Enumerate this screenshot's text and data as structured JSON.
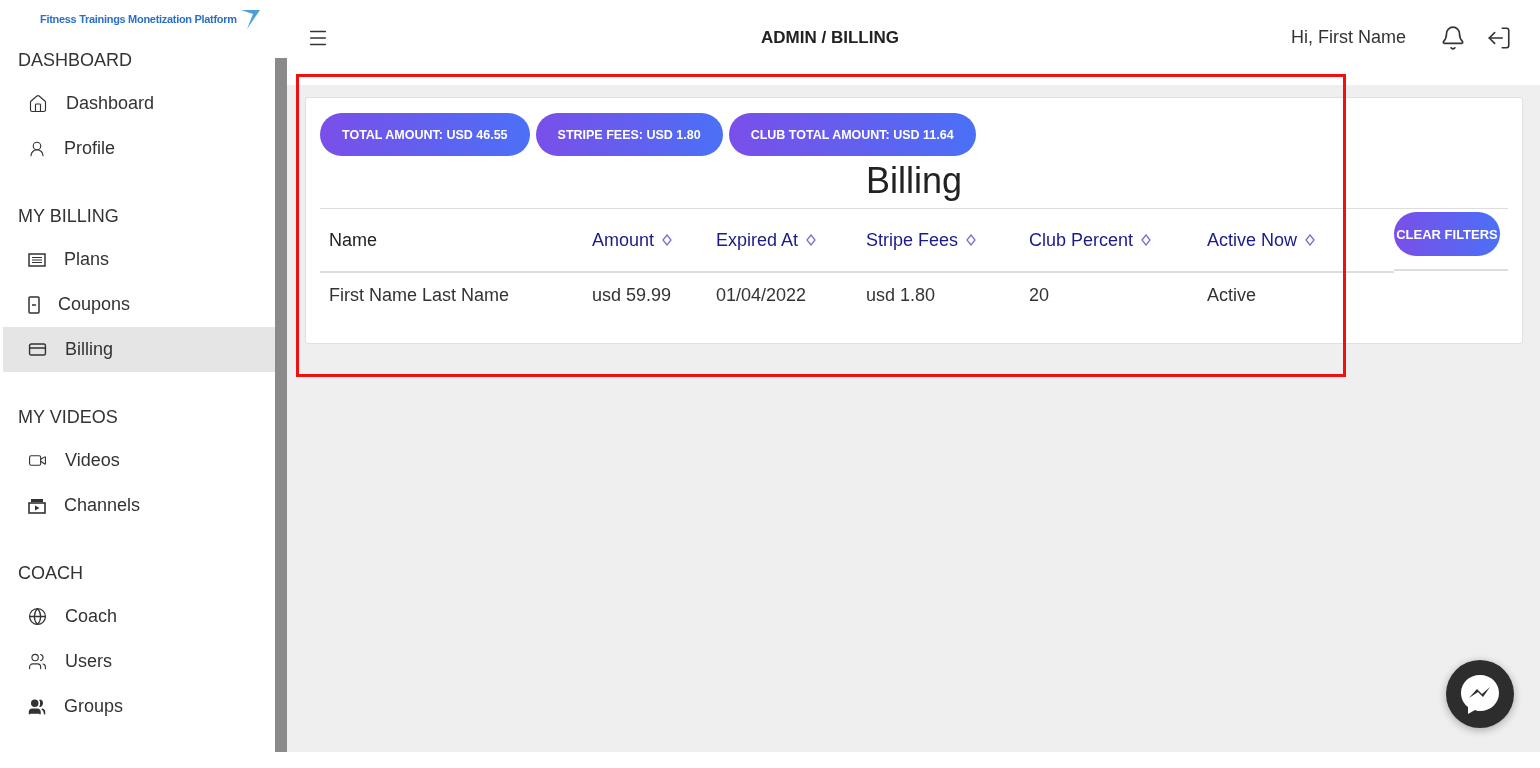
{
  "logo": {
    "text": "Fitness Trainings Monetization Platform"
  },
  "sidebar": {
    "sections": [
      {
        "title": "DASHBOARD",
        "items": [
          {
            "label": "Dashboard",
            "selected": false
          },
          {
            "label": "Profile",
            "selected": false
          }
        ]
      },
      {
        "title": "MY BILLING",
        "items": [
          {
            "label": "Plans",
            "selected": false
          },
          {
            "label": "Coupons",
            "selected": false
          },
          {
            "label": "Billing",
            "selected": true
          }
        ]
      },
      {
        "title": "MY VIDEOS",
        "items": [
          {
            "label": "Videos",
            "selected": false
          },
          {
            "label": "Channels",
            "selected": false
          }
        ]
      },
      {
        "title": "COACH",
        "items": [
          {
            "label": "Coach",
            "selected": false
          },
          {
            "label": "Users",
            "selected": false
          },
          {
            "label": "Groups",
            "selected": false
          }
        ]
      }
    ]
  },
  "header": {
    "breadcrumb": "ADMIN / BILLING",
    "greeting": "Hi, First Name"
  },
  "summary_chips": [
    "TOTAL AMOUNT: USD 46.55",
    "STRIPE FEES: USD 1.80",
    "CLUB TOTAL AMOUNT: USD 11.64"
  ],
  "title": "Billing",
  "table": {
    "columns": [
      {
        "label": "Name",
        "sortable": false
      },
      {
        "label": "Amount",
        "sortable": true
      },
      {
        "label": "Expired At",
        "sortable": true
      },
      {
        "label": "Stripe Fees",
        "sortable": true
      },
      {
        "label": "Club Percent",
        "sortable": true
      },
      {
        "label": "Active Now",
        "sortable": true
      }
    ],
    "rows": [
      [
        "First Name Last Name",
        "usd 59.99",
        "01/04/2022",
        "usd 1.80",
        "20",
        "Active"
      ]
    ],
    "clear_button": "CLEAR FILTERS"
  }
}
